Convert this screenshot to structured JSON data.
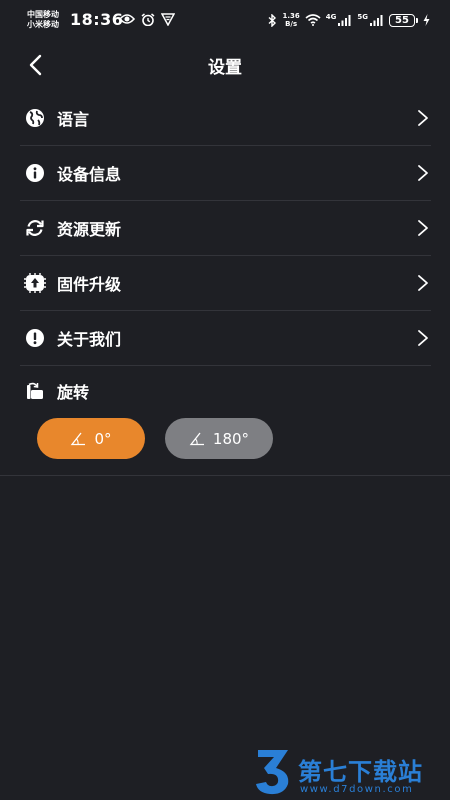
{
  "status_bar": {
    "carrier_1": "中国移动",
    "carrier_2": "小米移动",
    "time": "18:36",
    "speed_value": "1.36",
    "speed_unit": "B/s",
    "network_1": "4G",
    "network_2": "5G",
    "battery": "55",
    "icons": [
      "eye-icon",
      "alarm-icon",
      "vpn-icon",
      "bluetooth-icon",
      "wifi-icon",
      "signal-icon",
      "charging-icon"
    ]
  },
  "header": {
    "title": "设置",
    "back_icon": "chevron-left-icon"
  },
  "settings": {
    "items": [
      {
        "label": "语言",
        "icon": "globe-icon"
      },
      {
        "label": "设备信息",
        "icon": "info-icon"
      },
      {
        "label": "资源更新",
        "icon": "refresh-icon"
      },
      {
        "label": "固件升级",
        "icon": "firmware-upgrade-icon"
      },
      {
        "label": "关于我们",
        "icon": "exclamation-icon"
      }
    ]
  },
  "rotate": {
    "label": "旋转",
    "icon": "rotate-icon",
    "options": [
      {
        "label": "0°",
        "selected": true
      },
      {
        "label": "180°",
        "selected": false
      }
    ]
  },
  "watermark": {
    "title": "第七下载站",
    "url": "www.d7down.com"
  },
  "colors": {
    "background": "#1e1f24",
    "accent": "#e8872c",
    "inactive": "#7e7f83",
    "divider": "#33343a",
    "watermark": "#2a7fd6"
  }
}
